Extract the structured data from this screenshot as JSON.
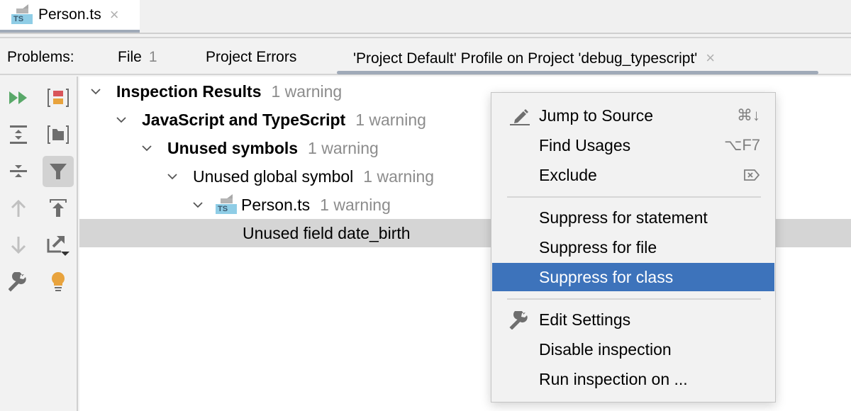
{
  "editor": {
    "tab": {
      "file_icon": "typescript-file-icon",
      "icon_label": "TS",
      "title": "Person.ts",
      "close": "×"
    }
  },
  "problems": {
    "label": "Problems:",
    "tabs": [
      {
        "label": "File",
        "count": "1"
      },
      {
        "label": "Project Errors",
        "count": ""
      },
      {
        "label": "'Project Default' Profile on Project 'debug_typescript'",
        "close": "×",
        "active": true
      }
    ]
  },
  "toolbar": {
    "buttons": [
      {
        "icon": "rerun-icon"
      },
      {
        "icon": "group-by-severity-icon"
      },
      {
        "icon": "expand-all-icon"
      },
      {
        "icon": "group-by-directory-icon"
      },
      {
        "icon": "collapse-all-icon"
      },
      {
        "icon": "filter-icon",
        "active": true
      },
      {
        "icon": "previous-problem-icon",
        "disabled": true
      },
      {
        "icon": "export-icon"
      },
      {
        "icon": "next-problem-icon",
        "disabled": true
      },
      {
        "icon": "autoscroll-to-source-icon"
      },
      {
        "icon": "edit-settings-icon"
      },
      {
        "icon": "quick-fix-bulb-icon"
      }
    ]
  },
  "tree": {
    "rows": [
      {
        "label": "Inspection Results",
        "count": "1 warning",
        "bold": true,
        "expanded": true
      },
      {
        "label": "JavaScript and TypeScript",
        "count": "1 warning",
        "bold": true,
        "expanded": true
      },
      {
        "label": "Unused symbols",
        "count": "1 warning",
        "bold": true,
        "expanded": true
      },
      {
        "label": "Unused global symbol",
        "count": "1 warning",
        "bold": false,
        "expanded": true
      },
      {
        "label": "Person.ts",
        "count": "1 warning",
        "bold": false,
        "expanded": true,
        "icon": "TS"
      },
      {
        "label": "Unused field date_birth",
        "count": "",
        "bold": false,
        "selected": true
      }
    ]
  },
  "context_menu": {
    "items": [
      {
        "label": "Jump to Source",
        "shortcut": "⌘↓",
        "icon": "pencil-icon"
      },
      {
        "label": "Find Usages",
        "shortcut": "⌥F7"
      },
      {
        "label": "Exclude",
        "shortcut": "⌦",
        "shortcut_icon": "delete-key-icon"
      },
      {
        "label": "Suppress for statement"
      },
      {
        "label": "Suppress for file"
      },
      {
        "label": "Suppress for class",
        "highlighted": true
      },
      {
        "label": "Edit Settings",
        "icon": "wrench-icon"
      },
      {
        "label": "Disable inspection"
      },
      {
        "label": "Run inspection on ..."
      }
    ]
  },
  "colors": {
    "highlight": "#3d73bb",
    "selected_row": "#d5d5d5",
    "run_green": "#59a869",
    "bulb_orange": "#e8a33d",
    "severity_red": "#d9555a"
  }
}
